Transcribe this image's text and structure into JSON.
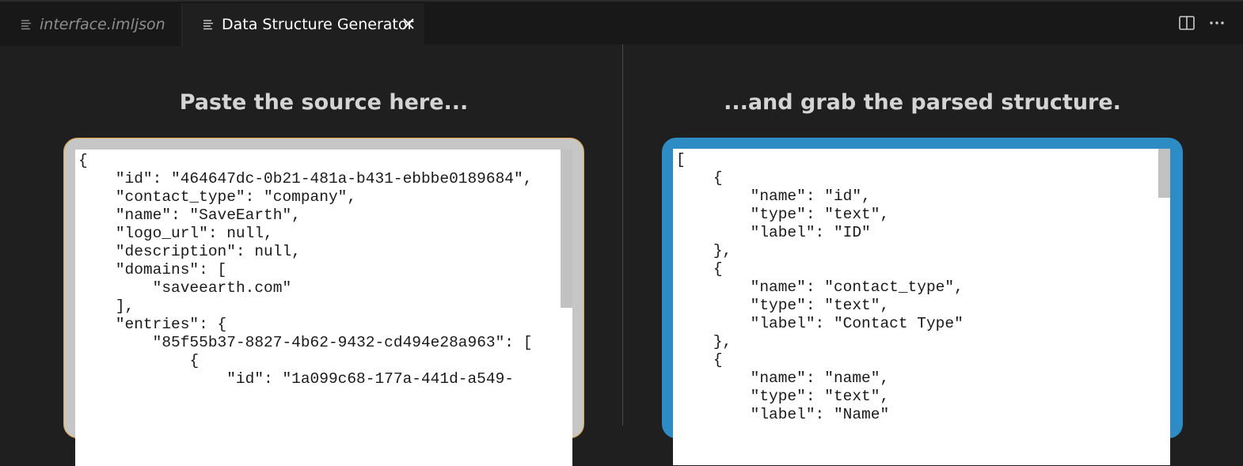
{
  "tabs": [
    {
      "label": "interface.imljson",
      "icon": "lines-icon",
      "active": false
    },
    {
      "label": "Data Structure Generator",
      "icon": "lines-icon",
      "active": true
    }
  ],
  "toolbar": {
    "split_icon": "split-editor-icon",
    "more_icon": "more-actions-icon"
  },
  "left": {
    "heading": "Paste the source here...",
    "source": "{\n    \"id\": \"464647dc-0b21-481a-b431-ebbbe0189684\",\n    \"contact_type\": \"company\",\n    \"name\": \"SaveEarth\",\n    \"logo_url\": null,\n    \"description\": null,\n    \"domains\": [\n        \"saveearth.com\"\n    ],\n    \"entries\": {\n        \"85f55b37-8827-4b62-9432-cd494e28a963\": [\n            {\n                \"id\": \"1a099c68-177a-441d-a549-"
  },
  "right": {
    "heading": "...and grab the parsed structure.",
    "output": "[\n    {\n        \"name\": \"id\",\n        \"type\": \"text\",\n        \"label\": \"ID\"\n    },\n    {\n        \"name\": \"contact_type\",\n        \"type\": \"text\",\n        \"label\": \"Contact Type\"\n    },\n    {\n        \"name\": \"name\",\n        \"type\": \"text\",\n        \"label\": \"Name\""
  },
  "colors": {
    "accent": "#2e8cc4",
    "focus_border": "#e0a43b",
    "background": "#1f1f1f"
  }
}
